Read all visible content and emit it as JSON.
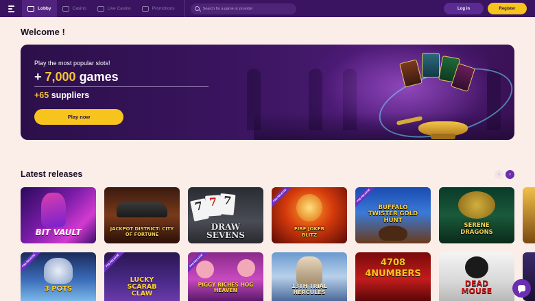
{
  "nav": {
    "items": [
      {
        "label": "Lobby",
        "icon": "home-icon",
        "active": true
      },
      {
        "label": "Casino",
        "icon": "grid-icon",
        "active": false
      },
      {
        "label": "Live Casino",
        "icon": "live-icon",
        "active": false
      },
      {
        "label": "Promotions",
        "icon": "megaphone-icon",
        "active": false
      }
    ],
    "search_placeholder": "Search for a game or provider",
    "login_label": "Log in",
    "register_label": "Register"
  },
  "welcome": {
    "title": "Welcome !",
    "subtitle": "Play the most popular slots!",
    "games_prefix": "+ ",
    "games_number": "7,000",
    "games_suffix": " games",
    "suppliers_number": "+65",
    "suppliers_suffix": " suppliers",
    "play_label": "Play now"
  },
  "latest": {
    "title": "Latest releases",
    "prev_icon": "chevron-left-icon",
    "next_icon": "chevron-right-icon",
    "row1": [
      {
        "name": "BIT VAULT",
        "ribbon": ""
      },
      {
        "name": "JACKPOT DISTRICT: CITY OF FORTUNE",
        "ribbon": ""
      },
      {
        "name": "DRAW SEVENS",
        "ribbon": ""
      },
      {
        "name": "FIRE JOKER BLITZ",
        "ribbon": "PRE-RELEASE"
      },
      {
        "name": "BUFFALO TWISTER GOLD HUNT",
        "ribbon": "PRE-RELEASE"
      },
      {
        "name": "SERENE DRAGONS",
        "ribbon": ""
      }
    ],
    "row2": [
      {
        "name": "3 POTS",
        "ribbon": "PRE-RELEASE"
      },
      {
        "name": "LUCKY SCARAB CLAW",
        "ribbon": "PRE-RELEASE"
      },
      {
        "name": "PIGGY RICHES HOG HEAVEN",
        "ribbon": "PRE-RELEASE"
      },
      {
        "name": "13TH TRIAL HERCULES",
        "ribbon": ""
      },
      {
        "name": "4708 4NUMBERS",
        "ribbon": ""
      },
      {
        "name": "DEAD MOUSE",
        "ribbon": ""
      }
    ]
  },
  "colors": {
    "nav_bg": "#3a1460",
    "accent_yellow": "#f6c41d",
    "accent_purple": "#6a2fb0",
    "page_bg": "#fbeee8"
  }
}
